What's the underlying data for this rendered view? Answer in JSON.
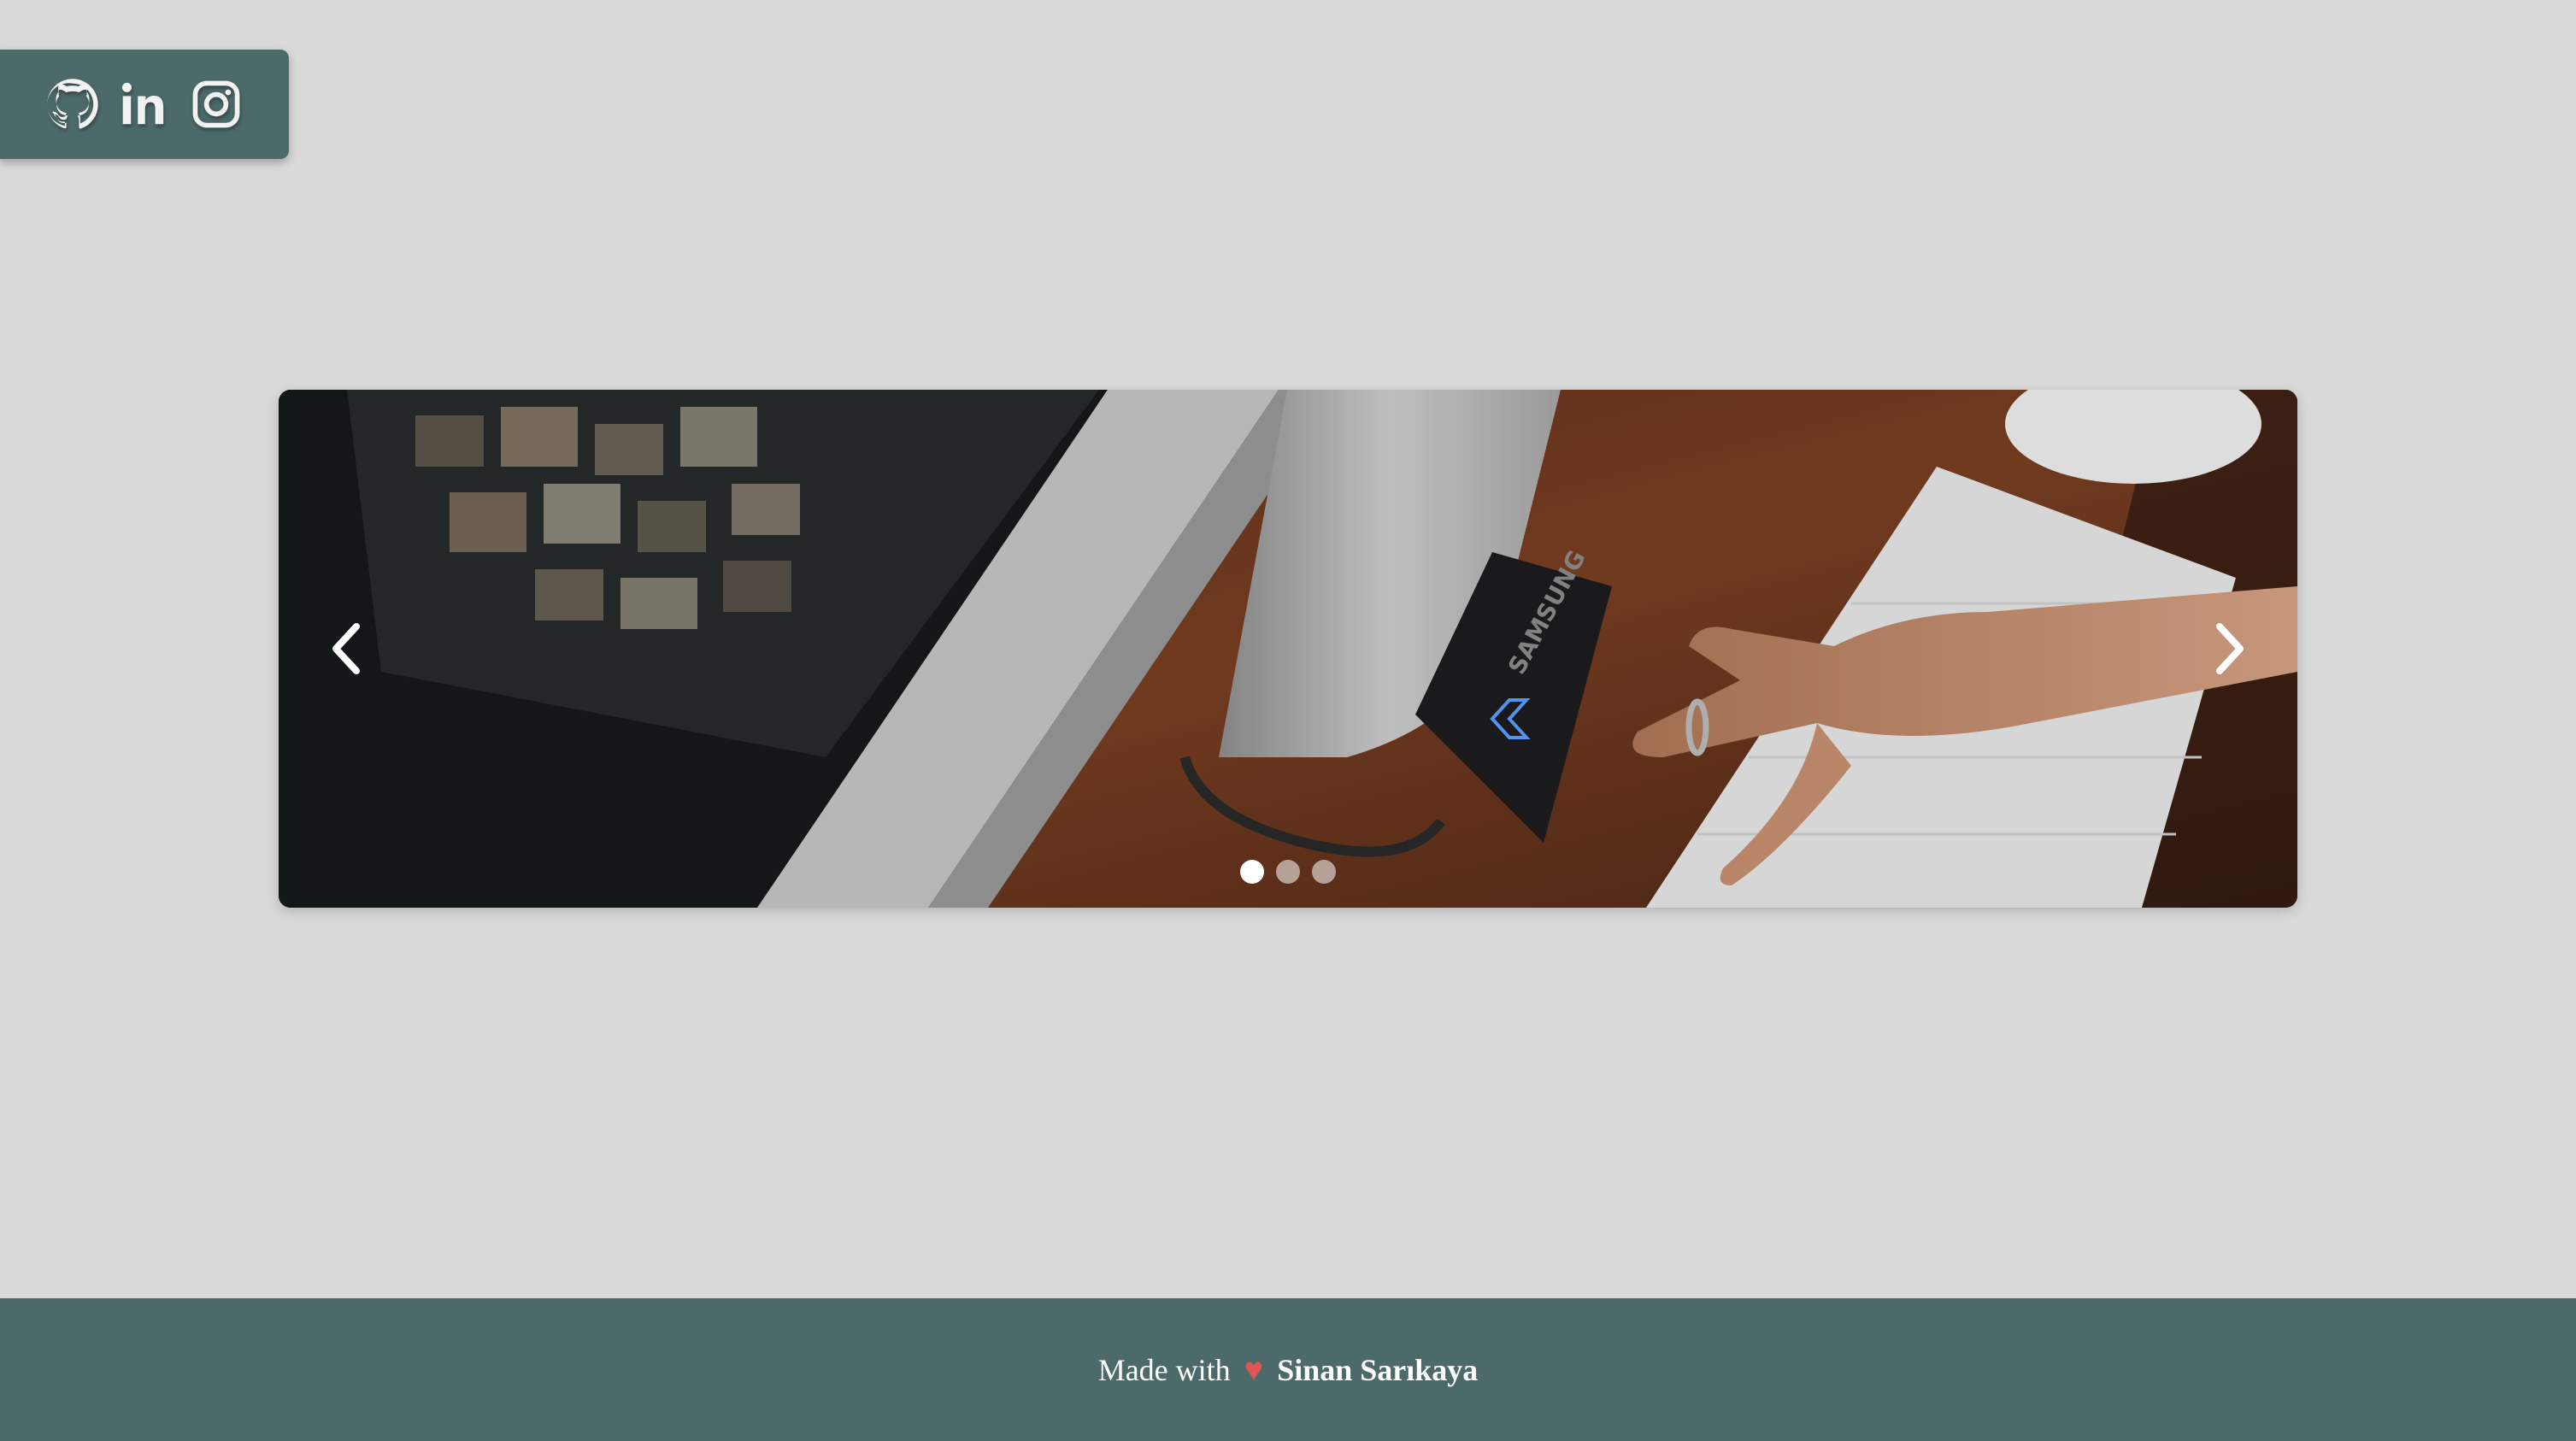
{
  "social": {
    "links": [
      {
        "icon": "github-icon"
      },
      {
        "icon": "linkedin-icon"
      },
      {
        "icon": "instagram-icon"
      }
    ],
    "background": "#4d6a6a"
  },
  "carousel": {
    "image_alt": "",
    "active_index": 0,
    "slide_count": 3,
    "prev_icon": "chevron-left-icon",
    "next_icon": "chevron-right-icon"
  },
  "footer": {
    "made_with": "Made with",
    "heart": "♥",
    "author": "Sinan Sarıkaya",
    "background": "#4d6a6a",
    "heart_color": "#e05555"
  },
  "page": {
    "background": "#d9d9d9"
  }
}
